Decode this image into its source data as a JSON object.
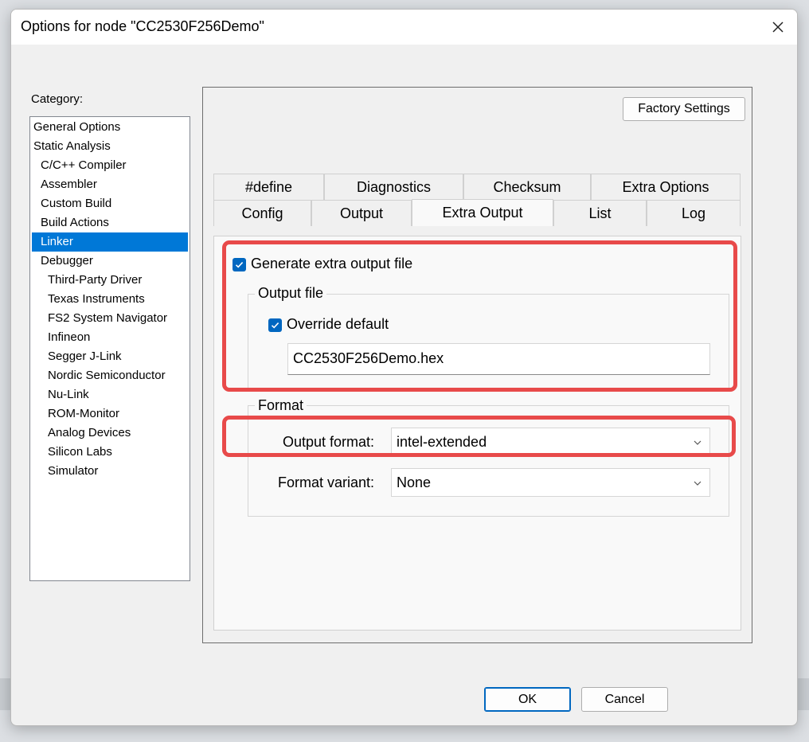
{
  "window": {
    "title": "Options for node \"CC2530F256Demo\""
  },
  "category": {
    "label": "Category:",
    "items": [
      {
        "label": "General Options",
        "level": 0
      },
      {
        "label": "Static Analysis",
        "level": 0
      },
      {
        "label": "C/C++ Compiler",
        "level": 1
      },
      {
        "label": "Assembler",
        "level": 1
      },
      {
        "label": "Custom Build",
        "level": 1
      },
      {
        "label": "Build Actions",
        "level": 1
      },
      {
        "label": "Linker",
        "level": 1,
        "selected": true
      },
      {
        "label": "Debugger",
        "level": 1
      },
      {
        "label": "Third-Party Driver",
        "level": 2
      },
      {
        "label": "Texas Instruments",
        "level": 2
      },
      {
        "label": "FS2 System Navigator",
        "level": 2
      },
      {
        "label": "Infineon",
        "level": 2
      },
      {
        "label": "Segger J-Link",
        "level": 2
      },
      {
        "label": "Nordic Semiconductor",
        "level": 2
      },
      {
        "label": "Nu-Link",
        "level": 2
      },
      {
        "label": "ROM-Monitor",
        "level": 2
      },
      {
        "label": "Analog Devices",
        "level": 2
      },
      {
        "label": "Silicon Labs",
        "level": 2
      },
      {
        "label": "Simulator",
        "level": 2
      }
    ]
  },
  "factory_settings_label": "Factory Settings",
  "tabs": {
    "row_top": [
      "#define",
      "Diagnostics",
      "Checksum",
      "Extra Options"
    ],
    "row_bottom": [
      "Config",
      "Output",
      "Extra Output",
      "List",
      "Log"
    ],
    "active": "Extra Output"
  },
  "extra_output": {
    "generate_label": "Generate extra output file",
    "generate_checked": true,
    "output_file_group": "Output file",
    "override_label": "Override default",
    "override_checked": true,
    "filename": "CC2530F256Demo.hex",
    "format_group": "Format",
    "output_format_label": "Output format:",
    "output_format_value": "intel-extended",
    "format_variant_label": "Format variant:",
    "format_variant_value": "None"
  },
  "buttons": {
    "ok": "OK",
    "cancel": "Cancel"
  },
  "colors": {
    "accent": "#0067c0",
    "selection": "#0078d7",
    "highlight": "#e84a4a"
  }
}
